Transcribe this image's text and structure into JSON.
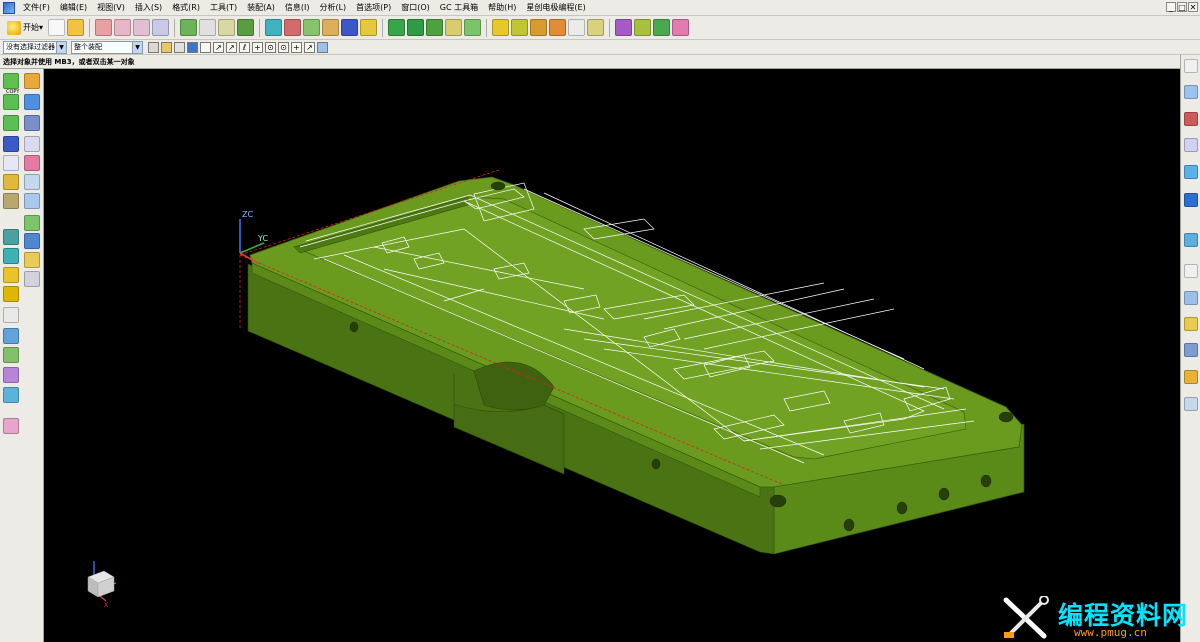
{
  "menubar": {
    "items": [
      "文件(F)",
      "编辑(E)",
      "视图(V)",
      "插入(S)",
      "格式(R)",
      "工具(T)",
      "装配(A)",
      "信息(I)",
      "分析(L)",
      "首选项(P)",
      "窗口(O)",
      "GC 工具箱",
      "帮助(H)",
      "星创电极编程(E)"
    ]
  },
  "toolbar": {
    "start_label": "开始",
    "start_arrow": "▾"
  },
  "selection_bar": {
    "type_filter": "没有选择过滤器",
    "scope": "整个装配",
    "dd": "▼"
  },
  "cue": {
    "text": "选择对象并使用 MB3，或者双击某一对象"
  },
  "left_toolbar": {
    "copy_label": "COPY"
  },
  "viewport": {
    "zc_label": "ZC",
    "yc_label": "YC",
    "model_color": "#6a9a1e",
    "triad_x_label": "X"
  },
  "watermark": {
    "text": "编程资料网",
    "url": "www.pmug.cn"
  },
  "window_controls": {
    "min": "_",
    "max": "□",
    "close": "✕"
  },
  "small_tools": [
    "↗",
    "↗",
    "ℓ",
    "+",
    "⊙",
    "⊙",
    "+",
    "↗"
  ]
}
